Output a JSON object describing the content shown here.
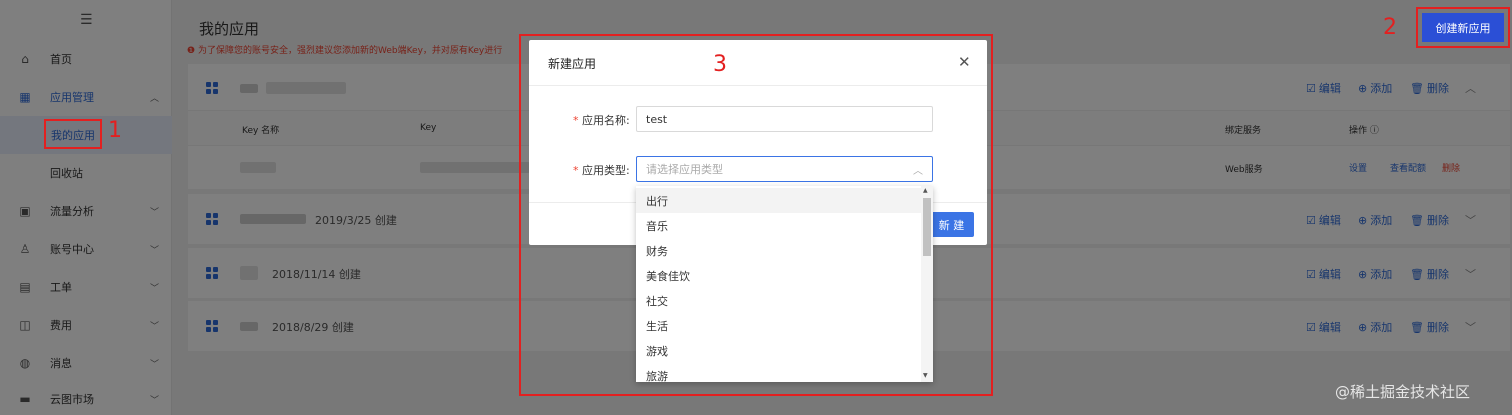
{
  "sidebar": {
    "menu_icon": "hamburger-icon",
    "items": [
      {
        "label": "首页",
        "icon": "home-icon"
      },
      {
        "label": "应用管理",
        "icon": "grid-icon",
        "expanded": true
      },
      {
        "label": "我的应用"
      },
      {
        "label": "回收站"
      },
      {
        "label": "流量分析",
        "icon": "chart-icon"
      },
      {
        "label": "账号中心",
        "icon": "user-icon"
      },
      {
        "label": "工单",
        "icon": "ticket-icon"
      },
      {
        "label": "费用",
        "icon": "money-icon"
      },
      {
        "label": "消息",
        "icon": "message-icon"
      },
      {
        "label": "云图市场",
        "icon": "store-icon"
      }
    ]
  },
  "page": {
    "title": "我的应用",
    "warning": "为了保障您的账号安全，强烈建议您添加新的Web端Key，并对原有Key进行",
    "create_button": "创建新应用"
  },
  "app_list": {
    "columns": [
      "Key 名称",
      "Key",
      "绑定服务",
      "操作"
    ],
    "row": {
      "service": "Web服务",
      "ops": [
        "设置",
        "查看配额",
        "删除"
      ]
    },
    "apps": [
      {
        "date": ""
      },
      {
        "date": "2019/3/25 创建"
      },
      {
        "date": "2018/11/14 创建"
      },
      {
        "date": "2018/8/29 创建"
      }
    ],
    "actions": {
      "edit": "编辑",
      "add": "添加",
      "delete": "删除"
    }
  },
  "modal": {
    "title": "新建应用",
    "name_label": "应用名称:",
    "name_value": "test",
    "type_label": "应用类型:",
    "type_placeholder": "请选择应用类型",
    "submit": "新 建",
    "close_icon": "close-icon"
  },
  "dropdown": {
    "options": [
      "出行",
      "音乐",
      "财务",
      "美食佳饮",
      "社交",
      "生活",
      "游戏",
      "旅游"
    ]
  },
  "annotations": {
    "n1": "1",
    "n2": "2",
    "n3": "3"
  },
  "watermark": "@稀土掘金技术社区",
  "colors": {
    "primary": "#2b4fd6",
    "annotation": "#e32020",
    "link": "#2e6bd9"
  }
}
